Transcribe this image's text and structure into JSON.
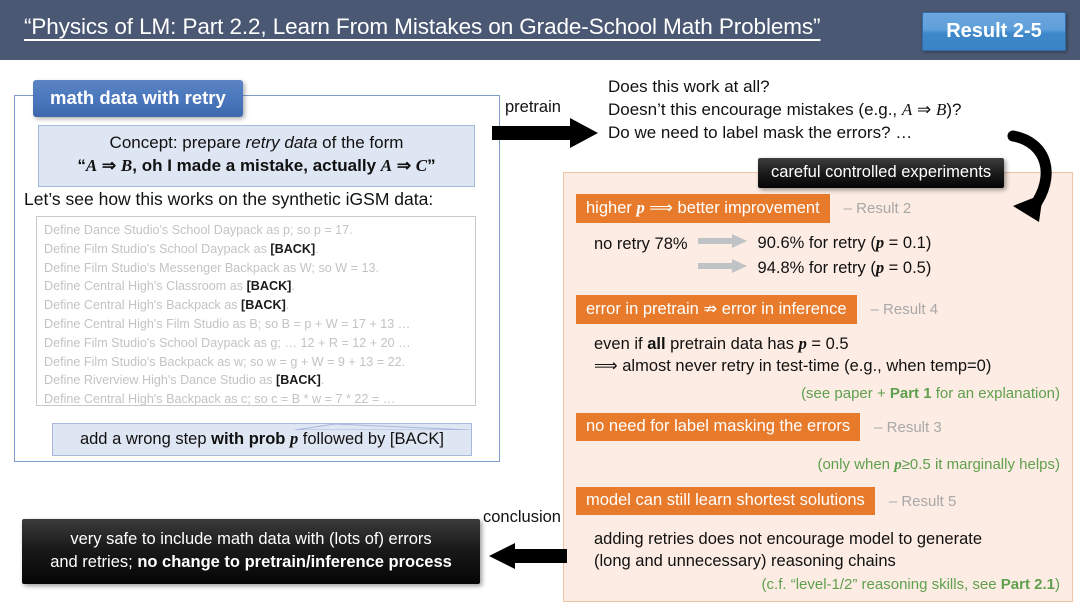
{
  "header": {
    "title": "“Physics of LM: Part 2.2, Learn From Mistakes on Grade-School Math Problems”",
    "badge": "Result 2-5",
    "bar_color": "#4a5873",
    "badge_color": "#5f9fda"
  },
  "left_panel": {
    "tab_label": "math data with retry",
    "concept": {
      "line1_pre": "Concept: prepare ",
      "line1_italic": "retry data",
      "line1_post": " of the form",
      "line2": "“A ⇒ B, oh I made a mistake, actually A ⇒ C”"
    },
    "lets_see": "Let’s see how this works on the synthetic iGSM data:",
    "code_lines": [
      {
        "pre": "Define Dance Studio's School Daypack as p; so p = 17.",
        "bold": "",
        "post": ""
      },
      {
        "pre": "Define Film Studio's School Daypack as ",
        "bold": "[BACK]",
        "post": "."
      },
      {
        "pre": "Define Film Studio's Messenger Backpack as W; so W = 13.",
        "bold": "",
        "post": ""
      },
      {
        "pre": "Define Central High's Classroom as ",
        "bold": "[BACK]",
        "post": "."
      },
      {
        "pre": "Define Central High's Backpack as ",
        "bold": "[BACK]",
        "post": "."
      },
      {
        "pre": "Define Central High's Film Studio as B; so B = p + W = 17 + 13 …",
        "bold": "",
        "post": ""
      },
      {
        "pre": "Define Film Studio's School Daypack as g; … 12 + R = 12 + 20 …",
        "bold": "",
        "post": ""
      },
      {
        "pre": "Define Film Studio's Backpack as w; so w = g + W = 9 + 13 = 22.",
        "bold": "",
        "post": ""
      },
      {
        "pre": "Define Riverview High's Dance Studio as ",
        "bold": "[BACK]",
        "post": "."
      },
      {
        "pre": "Define Central High's Backpack as c; so c = B * w = 7 * 22 = …",
        "bold": "",
        "post": ""
      }
    ],
    "prob_box": {
      "pre": "add a wrong step ",
      "bold": "with prob p",
      "post": " followed by [BACK]"
    }
  },
  "flow": {
    "pretrain_label": "pretrain",
    "conclusion_label": "conclusion",
    "cce_badge": "careful controlled experiments"
  },
  "questions": [
    "Does this work at all?",
    "Doesn’t this encourage mistakes (e.g., A ⇒ B)?",
    "Do we need to label mask the errors? …"
  ],
  "results": {
    "accent_color": "#e87a2c",
    "panel_bg": "#fdece3",
    "green": "#5fa04e",
    "items": [
      {
        "label": "higher p ⟹ better improvement",
        "tag": "– Result 2",
        "baseline": "no retry 78%",
        "arrows": [
          "90.6% for retry (p = 0.1)",
          "94.8% for retry (p = 0.5)"
        ]
      },
      {
        "label": "error in pretrain ⇏ error in inference",
        "tag": "– Result 4",
        "body_line1_pre": "even if ",
        "body_line1_bold": "all",
        "body_line1_post": " pretrain data has p = 0.5",
        "body_line2": "⟹ almost never retry in test-time (e.g., when temp=0)",
        "note_pre": "(see paper + ",
        "note_bold": "Part 1",
        "note_post": " for an explanation)"
      },
      {
        "label": "no need for label masking the errors",
        "tag": "– Result 3",
        "note": "(only when p≥0.5 it marginally helps)"
      },
      {
        "label": "model can still learn shortest solutions",
        "tag": "– Result 5",
        "body_line1": "adding retries does not encourage model to generate",
        "body_line2": "(long and unnecessary) reasoning chains",
        "note_pre": "(c.f. “level-1/2” reasoning skills, see ",
        "note_bold": "Part 2.1",
        "note_post": ")"
      }
    ]
  },
  "conclusion_box": {
    "line1": "very safe to include math data with (lots of) errors",
    "line2_pre": "and retries; ",
    "line2_bold": "no change to pretrain/inference process"
  }
}
